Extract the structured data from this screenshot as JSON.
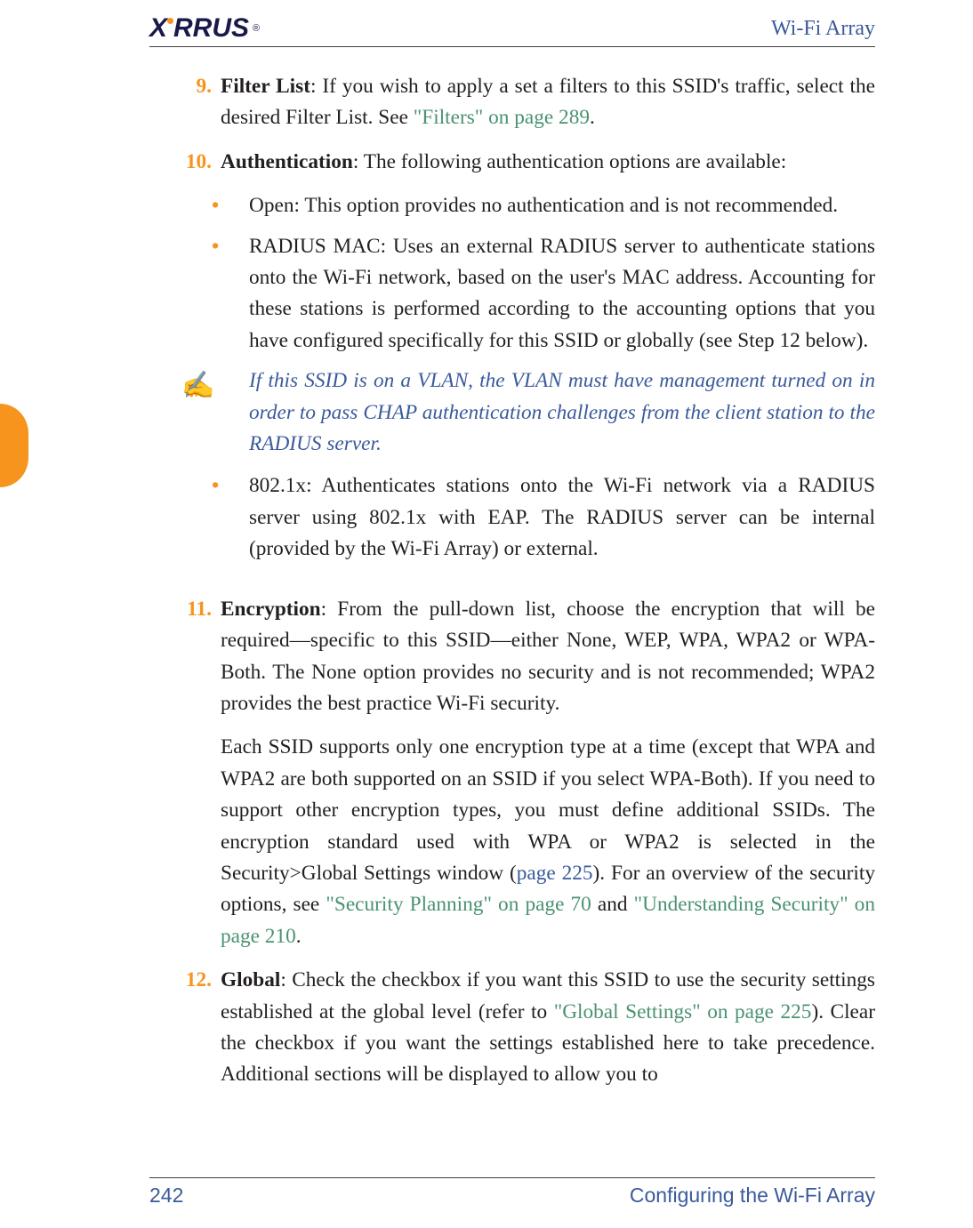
{
  "header": {
    "logo_text_1": "X",
    "logo_text_2": "RRUS",
    "logo_reg": "®",
    "brand": "Wi-Fi Array"
  },
  "items": {
    "i9": {
      "num": "9.",
      "title": "Filter List",
      "text_a": ": If you wish to apply a set a filters to this SSID's traffic, select the desired Filter List. See ",
      "link": "\"Filters\" on page 289",
      "text_b": "."
    },
    "i10": {
      "num": "10.",
      "title": "Authentication",
      "text": ": The following authentication options are available:",
      "bullets": {
        "b1": {
          "lead": "Open:",
          "text": " This option provides no authentication and is not recommended."
        },
        "b2": {
          "lead": "RADIUS MAC:",
          "text_a": " Uses an external RADIUS server to authenticate stations onto the Wi-Fi network, based on the user's MAC address. Accounting for these stations is performed according to the accounting options that you have configured specifically for this SSID or globally (see ",
          "link": "Step 12",
          "text_b": " below)."
        },
        "note": "If this SSID is on a VLAN, the VLAN must have management turned on in order to pass CHAP authentication challenges from the client station to the RADIUS server.",
        "b3": {
          "lead": "802.1x:",
          "text": " Authenticates stations onto the Wi-Fi network via a RADIUS server using 802.1x with EAP. The RADIUS server can be internal (provided by the Wi-Fi Array) or external."
        }
      }
    },
    "i11": {
      "num": "11.",
      "title": "Encryption",
      "p1": ": From the pull-down list, choose the encryption that will be required—specific to this SSID—either None, WEP, WPA, WPA2 or WPA-Both. The None option provides no security and is not recommended; WPA2 provides the best practice Wi-Fi security.",
      "p2_a": "Each SSID supports only one encryption type at a time (except that WPA and WPA2 are both supported on an SSID if you select WPA-Both). If you need to support other encryption types, you must define additional SSIDs. The encryption standard used with WPA or WPA2 is selected in the Security>Global Settings window (",
      "p2_link1": "page 225",
      "p2_b": "). For an overview of the security options, see ",
      "p2_link2": "\"Security Planning\" on page 70",
      "p2_c": " and ",
      "p2_link3": "\"Understanding Security\" on page 210",
      "p2_d": "."
    },
    "i12": {
      "num": "12.",
      "title": "Global",
      "text_a": ": Check the checkbox if you want this SSID to use the security settings established at the global level (refer to ",
      "link": "\"Global Settings\" on page 225",
      "text_b": "). Clear the checkbox if you want the settings established here to take precedence. Additional sections will be displayed to allow you to"
    }
  },
  "note_icon": "✍",
  "bullet_glyph": "•",
  "footer": {
    "page": "242",
    "section": "Configuring the Wi-Fi Array"
  }
}
